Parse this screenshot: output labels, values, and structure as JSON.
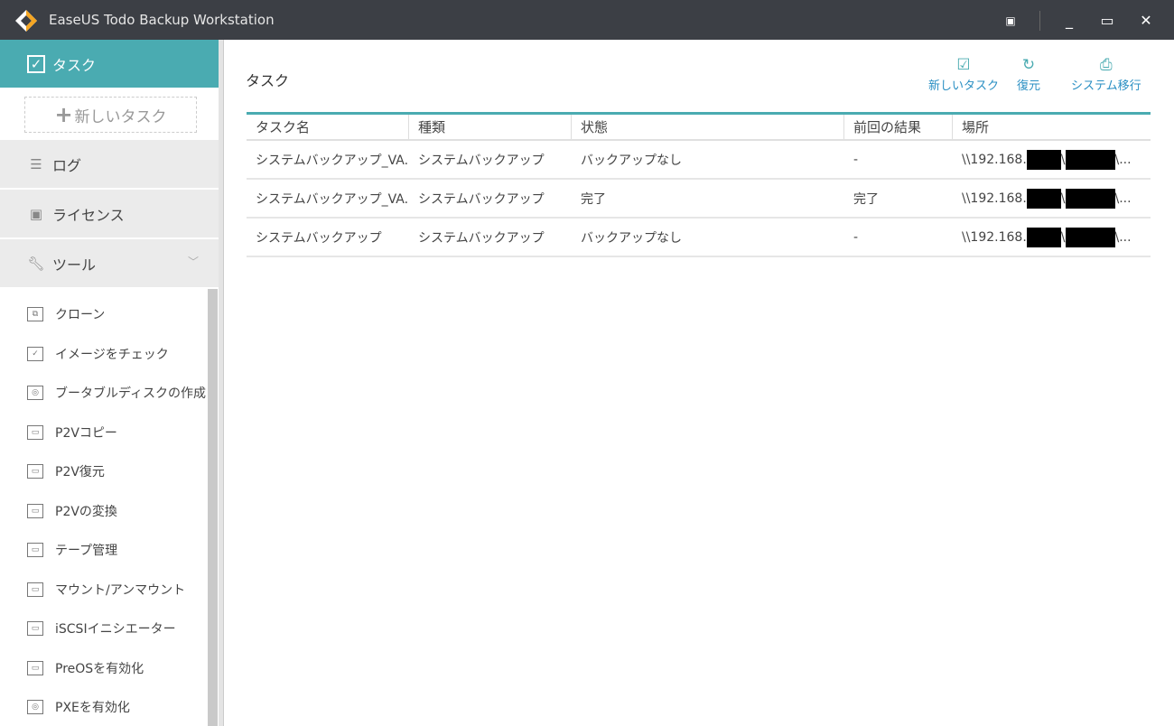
{
  "window": {
    "title": "EaseUS Todo Backup Workstation",
    "icons": [
      "menu-icon",
      "minimize-icon",
      "maximize-icon",
      "close-icon"
    ]
  },
  "sidebar": {
    "task": "タスク",
    "new_task": "新しいタスク",
    "log": "ログ",
    "license": "ライセンス",
    "tools": "ツール",
    "tool_items": [
      "クローン",
      "イメージをチェック",
      "ブータブルディスクの作成",
      "P2Vコピー",
      "P2V復元",
      "P2Vの変換",
      "テープ管理",
      "マウント/アンマウント",
      "iSCSIイニシエーター",
      "PreOSを有効化",
      "PXEを有効化"
    ]
  },
  "main": {
    "title": "タスク",
    "toolbar": {
      "new_task": "新しいタスク",
      "restore": "復元",
      "system_transfer": "システム移行"
    },
    "columns": [
      "タスク名",
      "種類",
      "状態",
      "前回の結果",
      "場所"
    ],
    "rows": [
      {
        "name": "システムバックアップ_VA...",
        "type": "システムバックアップ",
        "status": "バックアップなし",
        "last": "-",
        "loc_prefix": "\\\\192.168.",
        "loc_suffix": "\\..."
      },
      {
        "name": "システムバックアップ_VA...",
        "type": "システムバックアップ",
        "status": "完了",
        "last": "完了",
        "loc_prefix": "\\\\192.168.",
        "loc_suffix": "\\..."
      },
      {
        "name": "システムバックアップ",
        "type": "システムバックアップ",
        "status": "バックアップなし",
        "last": "-",
        "loc_prefix": "\\\\192.168.",
        "loc_suffix": "\\..."
      }
    ]
  },
  "colors": {
    "accent": "#4aabb1",
    "titlebar": "#3c3f45",
    "link": "#2a8fc3"
  }
}
